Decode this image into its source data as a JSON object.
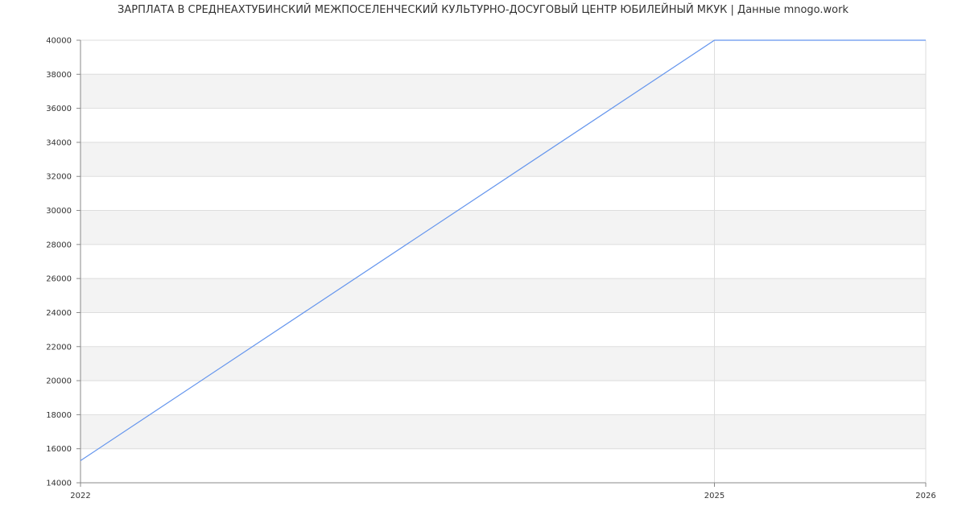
{
  "chart_data": {
    "type": "line",
    "title": "ЗАРПЛАТА В СРЕДНЕАХТУБИНСКИЙ МЕЖПОСЕЛЕНЧЕСКИЙ КУЛЬТУРНО-ДОСУГОВЫЙ ЦЕНТР ЮБИЛЕЙНЫЙ МКУК | Данные mnogo.work",
    "xlabel": "",
    "ylabel": "",
    "x_ticks": [
      "2022",
      "2025",
      "2026"
    ],
    "y_ticks": [
      "14000",
      "16000",
      "18000",
      "20000",
      "22000",
      "24000",
      "26000",
      "28000",
      "30000",
      "32000",
      "34000",
      "36000",
      "38000",
      "40000"
    ],
    "xlim": [
      2022,
      2026
    ],
    "ylim": [
      14000,
      40000
    ],
    "grid": true,
    "series": [
      {
        "x": [
          2022,
          2025,
          2026
        ],
        "y": [
          15300,
          40000,
          40000
        ],
        "color": "#6495ed"
      }
    ],
    "band_colors": [
      "#ffffff",
      "#f3f3f3"
    ],
    "grid_color": "#dddddd",
    "axis_color": "#888888"
  }
}
